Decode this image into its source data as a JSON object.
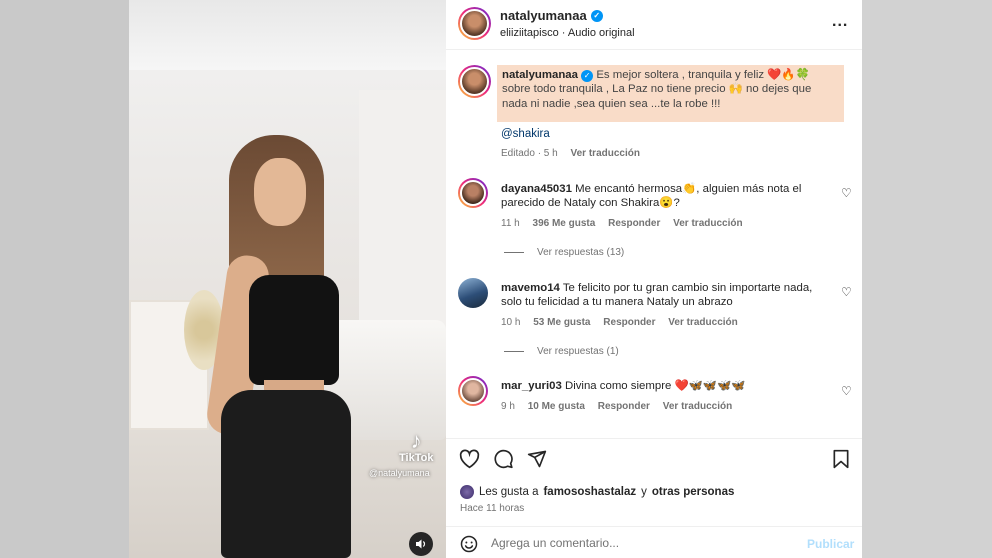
{
  "video": {
    "watermark_brand": "TikTok",
    "watermark_user": "@natalyumana"
  },
  "header": {
    "username": "natalyumanaa",
    "sub": "eliiziitapisco · Audio original",
    "more": "..."
  },
  "caption": {
    "username": "natalyumanaa",
    "text": "Es mejor soltera , tranquila y feliz ❤️🔥🍀 sobre todo tranquila , La Paz no tiene precio 🙌 no dejes que nada ni nadie ,sea quien sea ...te la robe !!!",
    "mention": "@shakira",
    "edited": "Editado · 5 h",
    "translate": "Ver traducción"
  },
  "comments": [
    {
      "username": "dayana45031",
      "text": "Me encantó hermosa👏, alguien más nota el parecido de Nataly con Shakira😮?",
      "time": "11 h",
      "likes": "396 Me gusta",
      "reply": "Responder",
      "translate": "Ver traducción",
      "replies": "Ver respuestas (13)"
    },
    {
      "username": "mavemo14",
      "text": "Te felicito por tu gran cambio sin importarte nada, solo tu felicidad a tu manera Nataly un abrazo",
      "time": "10 h",
      "likes": "53 Me gusta",
      "reply": "Responder",
      "translate": "Ver traducción",
      "replies": "Ver respuestas (1)"
    },
    {
      "username": "mar_yuri03",
      "text": "Divina como siempre ❤️🦋🦋🦋🦋",
      "time": "9 h",
      "likes": "10 Me gusta",
      "reply": "Responder",
      "translate": "Ver traducción"
    }
  ],
  "likes_bar": {
    "prefix": "Les gusta a",
    "user": "famososhastalaz",
    "joiner": "y",
    "others": "otras personas",
    "time_ago": "Hace 11 horas"
  },
  "add_comment": {
    "placeholder": "Agrega un comentario...",
    "publish": "Publicar"
  },
  "colors": {
    "caption_highlight": "#f9dcc8",
    "verified": "#0095f6",
    "link": "#00376b",
    "publish_disabled": "#b2dffc"
  },
  "icons": [
    "heart-icon",
    "comment-icon",
    "share-icon",
    "bookmark-icon",
    "emoji-icon",
    "volume-icon",
    "more-icon",
    "verified-icon"
  ]
}
